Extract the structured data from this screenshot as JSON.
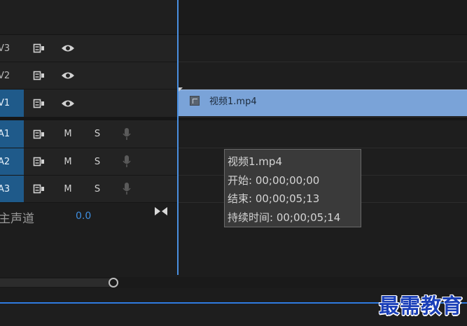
{
  "tracks": {
    "video": [
      {
        "label": "V3",
        "active": false
      },
      {
        "label": "V2",
        "active": false
      },
      {
        "label": "V1",
        "active": true
      }
    ],
    "audio": [
      {
        "label": "A1",
        "mute": "M",
        "solo": "S"
      },
      {
        "label": "A2",
        "mute": "M",
        "solo": "S"
      },
      {
        "label": "A3",
        "mute": "M",
        "solo": "S"
      }
    ],
    "master": {
      "label": "主声道",
      "value": "0.0"
    }
  },
  "clip": {
    "name": "视频1.mp4"
  },
  "tooltip": {
    "name": "视频1.mp4",
    "start": "开始: 00;00;00;00",
    "end": "结束: 00;00;05;13",
    "duration": "持续时间: 00;00;05;14"
  },
  "watermark": "最需教育",
  "icons": {
    "sync": "sync-lock-icon",
    "eye": "eye-icon",
    "mic": "microphone-icon",
    "master_end": "bowtie-icon"
  },
  "colors": {
    "accent": "#4a8fe0",
    "track_active": "#1f5a8a",
    "clip": "#7aa3d8",
    "value_blue": "#3e8ee0"
  }
}
